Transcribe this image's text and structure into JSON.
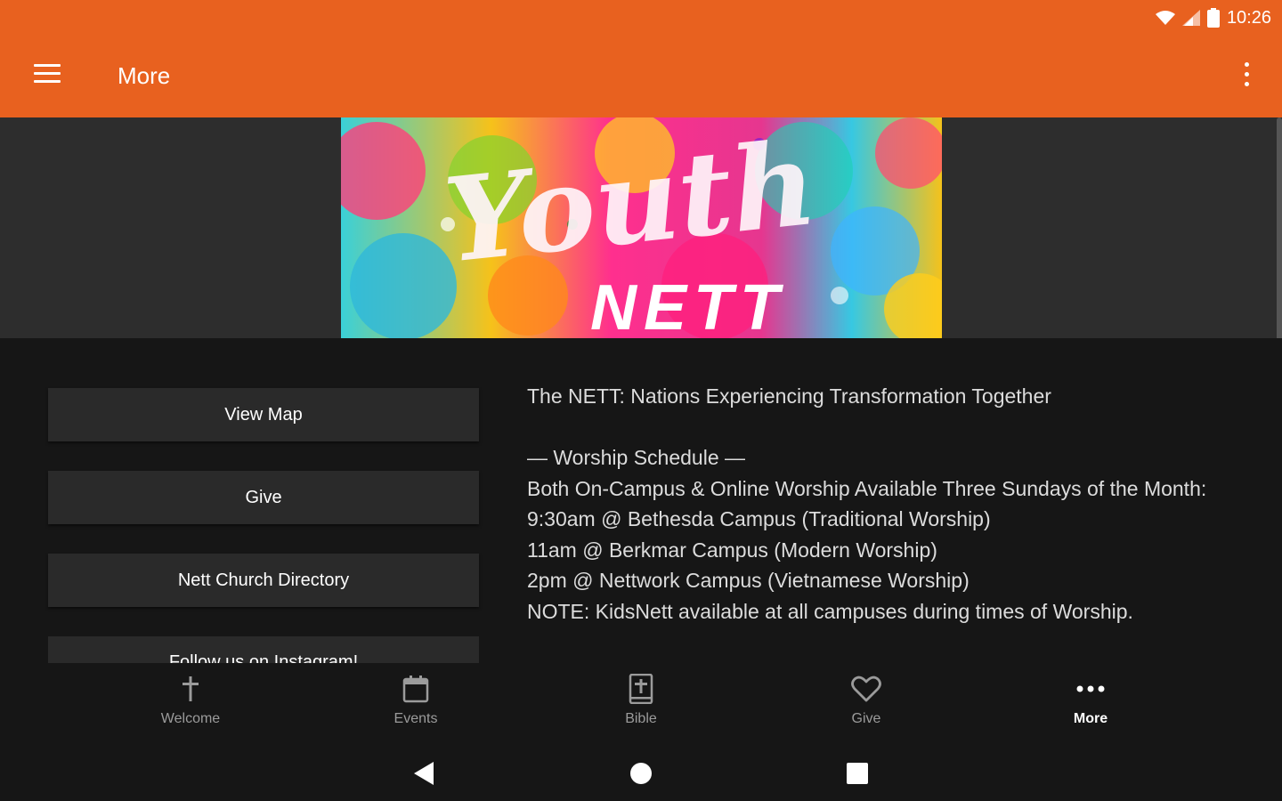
{
  "status_bar": {
    "time": "10:26"
  },
  "app_bar": {
    "title": "More"
  },
  "banner": {
    "line1": "Youth",
    "line2": "NETT"
  },
  "buttons": [
    {
      "label": "View Map"
    },
    {
      "label": "Give"
    },
    {
      "label": "Nett Church Directory"
    },
    {
      "label": "Follow us on Instagram!"
    }
  ],
  "description": {
    "line1": "The NETT: Nations Experiencing Transformation Together",
    "line2": "— Worship Schedule —",
    "line3": "Both On-Campus & Online Worship Available Three Sundays of the Month:",
    "line4": "9:30am @ Bethesda Campus (Traditional Worship)",
    "line5": "11am @ Berkmar Campus (Modern Worship)",
    "line6": "2pm @ Nettwork Campus (Vietnamese Worship)",
    "line7": "NOTE: KidsNett available at all campuses during times of Worship."
  },
  "bottom_nav": [
    {
      "label": "Welcome",
      "icon": "cross-icon"
    },
    {
      "label": "Events",
      "icon": "calendar-icon"
    },
    {
      "label": "Bible",
      "icon": "bible-icon"
    },
    {
      "label": "Give",
      "icon": "heart-icon"
    },
    {
      "label": "More",
      "icon": "more-dots-icon",
      "active": true
    }
  ],
  "colors": {
    "accent": "#e8611f",
    "background": "#161616",
    "banner_bg": "#2d2d2d",
    "button_bg": "#2a2a2a"
  }
}
